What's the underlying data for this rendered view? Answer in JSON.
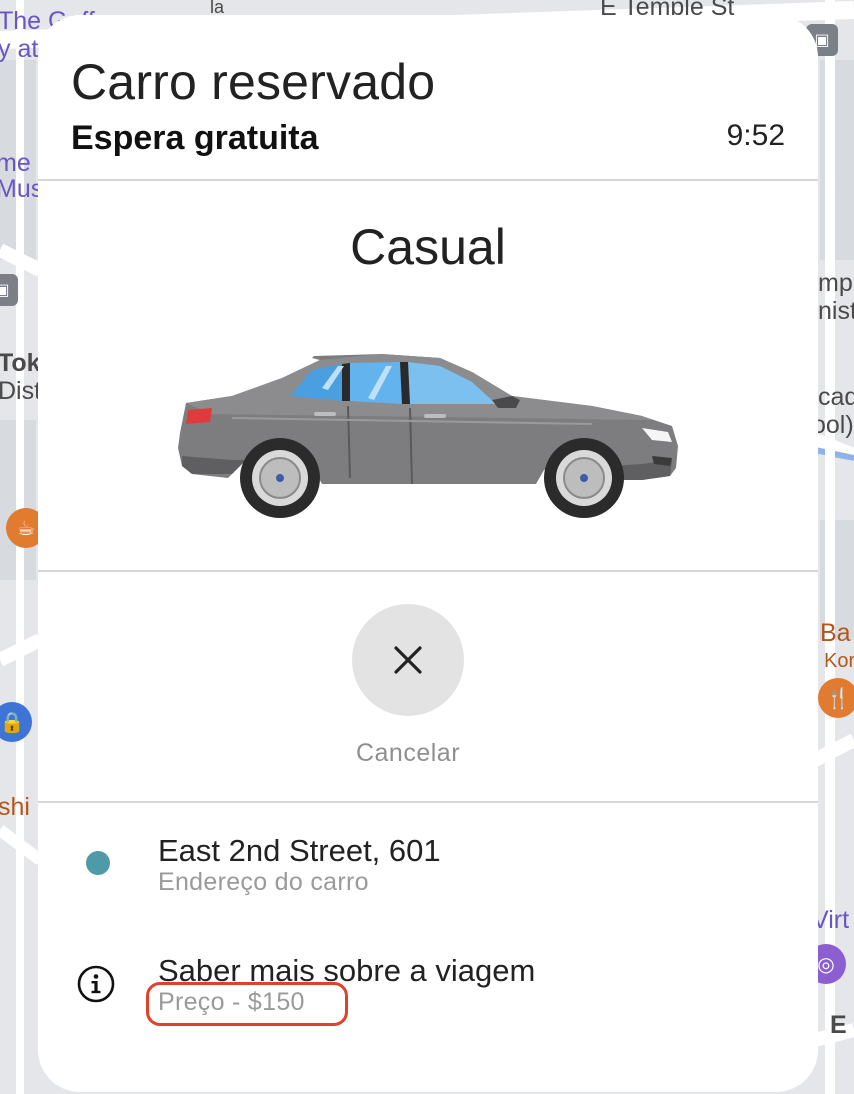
{
  "map": {
    "labels": [
      {
        "id": "gaff",
        "text": "The Gaff"
      },
      {
        "id": "gaff2",
        "text": "y at"
      },
      {
        "id": "street_top",
        "text": "E Temple St"
      },
      {
        "id": "ame",
        "text": "me"
      },
      {
        "id": "mus",
        "text": "Mus"
      },
      {
        "id": "tok",
        "text": "Tok"
      },
      {
        "id": "dist",
        "text": "Dist"
      },
      {
        "id": "shi",
        "text": "shi"
      },
      {
        "id": "mp",
        "text": "mp"
      },
      {
        "id": "nist",
        "text": "nist"
      },
      {
        "id": "cad",
        "text": "cad"
      },
      {
        "id": "ool",
        "text": "ool)"
      },
      {
        "id": "ba",
        "text": "Ba"
      },
      {
        "id": "kor",
        "text": "Kor"
      },
      {
        "id": "virt",
        "text": "Virt"
      },
      {
        "id": "e",
        "text": "E"
      },
      {
        "id": "la",
        "text": "la"
      }
    ]
  },
  "card": {
    "title": "Carro reservado",
    "subtitle": "Espera gratuita",
    "timer": "9:52",
    "car_class": "Casual",
    "cancel": {
      "label": "Cancelar",
      "icon": "close-icon"
    },
    "address": {
      "main": "East 2nd Street, 601",
      "sub": "Endereço do carro",
      "dot_color": "#4e9aa8"
    },
    "trip_info": {
      "main": "Saber mais sobre a viagem",
      "price": "Preço - $150",
      "icon": "info-icon"
    },
    "highlight_color": "#e0412c"
  }
}
